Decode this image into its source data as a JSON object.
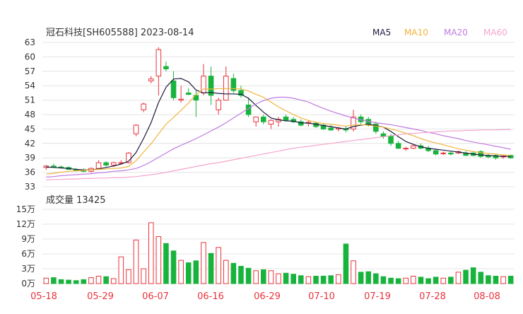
{
  "chart_data": {
    "type": "candlestick",
    "title": "冠石科技[SH605588] 2023-08-14",
    "legend": [
      {
        "name": "MA5",
        "color": "#1a1a3c"
      },
      {
        "name": "MA10",
        "color": "#f0b43c"
      },
      {
        "name": "MA20",
        "color": "#c07ae0"
      },
      {
        "name": "MA60",
        "color": "#f4a6cc"
      }
    ],
    "colors": {
      "up": "#e8343c",
      "down": "#18b33c",
      "grid": "#e4e4e4",
      "axis_text": "#333333",
      "date_text": "#e8343c"
    },
    "price_axis": {
      "ticks": [
        63,
        60,
        57,
        54,
        51,
        48,
        45,
        42,
        39,
        36,
        33
      ],
      "min": 33,
      "max": 63
    },
    "dates": [
      "05-18",
      "05-29",
      "06-07",
      "06-16",
      "06-29",
      "07-10",
      "07-19",
      "07-28",
      "08-08"
    ],
    "ohlc": [
      [
        37.0,
        37.5,
        36.5,
        37.3
      ],
      [
        37.3,
        37.8,
        37.0,
        37.1
      ],
      [
        37.1,
        37.4,
        36.8,
        37.0
      ],
      [
        37.0,
        37.2,
        36.5,
        36.6
      ],
      [
        36.6,
        36.9,
        36.2,
        36.4
      ],
      [
        36.4,
        36.8,
        36.0,
        36.2
      ],
      [
        36.2,
        37.0,
        35.9,
        36.8
      ],
      [
        36.8,
        38.5,
        36.5,
        38.0
      ],
      [
        38.0,
        38.3,
        37.2,
        37.5
      ],
      [
        37.5,
        38.2,
        37.1,
        38.0
      ],
      [
        38.0,
        38.5,
        37.6,
        38.0
      ],
      [
        38.0,
        40.2,
        37.8,
        40.0
      ],
      [
        44.0,
        46.0,
        43.5,
        45.8
      ],
      [
        49.0,
        50.5,
        48.5,
        50.2
      ],
      [
        55.0,
        56.0,
        54.5,
        55.4
      ],
      [
        56.0,
        62.0,
        52.0,
        61.5
      ],
      [
        58.0,
        59.0,
        57.0,
        57.5
      ],
      [
        55.0,
        57.0,
        51.0,
        51.5
      ],
      [
        51.0,
        54.0,
        50.5,
        51.2
      ],
      [
        52.5,
        53.5,
        52.0,
        52.2
      ],
      [
        52.0,
        53.0,
        47.5,
        51.0
      ],
      [
        52.5,
        58.5,
        52.0,
        56.0
      ],
      [
        56.0,
        58.0,
        50.0,
        52.0
      ],
      [
        49.0,
        51.5,
        48.0,
        51.0
      ],
      [
        51.0,
        58.0,
        51.0,
        56.0
      ],
      [
        55.5,
        56.5,
        52.5,
        53.0
      ],
      [
        53.0,
        54.0,
        51.5,
        52.0
      ],
      [
        50.0,
        51.5,
        47.5,
        48.0
      ],
      [
        46.5,
        47.5,
        45.5,
        47.5
      ],
      [
        47.5,
        48.0,
        46.0,
        46.5
      ],
      [
        46.0,
        47.0,
        45.0,
        46.8
      ],
      [
        46.5,
        47.5,
        45.5,
        47.0
      ],
      [
        47.5,
        48.0,
        46.5,
        46.8
      ],
      [
        47.0,
        47.5,
        46.2,
        46.5
      ],
      [
        46.5,
        47.0,
        45.5,
        45.8
      ],
      [
        46.2,
        46.8,
        45.5,
        46.4
      ],
      [
        46.2,
        46.5,
        45.2,
        45.5
      ],
      [
        45.8,
        46.2,
        44.8,
        45.0
      ],
      [
        45.2,
        45.8,
        44.6,
        44.8
      ],
      [
        45.0,
        45.5,
        44.5,
        45.2
      ],
      [
        45.0,
        45.5,
        44.3,
        44.8
      ],
      [
        45.0,
        49.0,
        44.5,
        47.5
      ],
      [
        47.5,
        48.0,
        46.0,
        46.5
      ],
      [
        47.0,
        47.5,
        45.5,
        46.0
      ],
      [
        46.0,
        46.5,
        44.0,
        44.5
      ],
      [
        44.0,
        44.5,
        43.0,
        43.5
      ],
      [
        43.5,
        44.0,
        41.5,
        42.0
      ],
      [
        42.0,
        42.5,
        40.8,
        41.0
      ],
      [
        41.0,
        41.3,
        40.5,
        41.0
      ],
      [
        41.0,
        41.8,
        40.8,
        41.5
      ],
      [
        41.5,
        42.0,
        40.8,
        41.0
      ],
      [
        41.0,
        41.5,
        40.2,
        40.5
      ],
      [
        40.5,
        40.8,
        39.5,
        39.8
      ],
      [
        40.0,
        40.3,
        39.6,
        40.0
      ],
      [
        40.0,
        40.3,
        39.5,
        39.8
      ],
      [
        40.0,
        40.5,
        39.8,
        40.3
      ],
      [
        40.0,
        40.4,
        39.4,
        39.5
      ],
      [
        40.0,
        40.3,
        39.3,
        39.5
      ],
      [
        40.3,
        40.6,
        39.0,
        39.3
      ],
      [
        39.5,
        39.8,
        38.9,
        39.2
      ],
      [
        39.5,
        39.8,
        38.6,
        39.0
      ],
      [
        39.2,
        39.5,
        38.8,
        39.4
      ],
      [
        39.5,
        39.7,
        38.8,
        39.0
      ]
    ],
    "ma": {
      "MA5": [
        37.1,
        37.0,
        36.9,
        36.8,
        36.6,
        36.5,
        36.5,
        36.7,
        37.0,
        37.3,
        37.7,
        38.3,
        40.1,
        43.0,
        46.3,
        50.5,
        53.7,
        55.4,
        55.5,
        54.8,
        53.1,
        52.5,
        52.6,
        52.4,
        52.3,
        52.3,
        52.2,
        51.4,
        49.9,
        48.5,
        47.3,
        46.9,
        46.7,
        46.6,
        46.3,
        46.2,
        46.0,
        45.7,
        45.5,
        45.2,
        45.0,
        45.5,
        45.8,
        46.0,
        45.7,
        45.4,
        44.5,
        43.4,
        42.4,
        41.8,
        41.3,
        41.0,
        40.8,
        40.6,
        40.4,
        40.2,
        40.0,
        39.8,
        39.6,
        39.5,
        39.4,
        39.3,
        39.3
      ],
      "MA10": [
        35.6,
        35.8,
        36.0,
        36.2,
        36.3,
        36.4,
        36.5,
        36.6,
        36.7,
        36.8,
        36.9,
        37.2,
        38.4,
        40.2,
        41.9,
        44.0,
        46.0,
        47.4,
        48.9,
        50.4,
        52.2,
        53.3,
        53.3,
        53.4,
        53.4,
        53.4,
        53.3,
        52.9,
        52.2,
        51.6,
        50.6,
        49.6,
        48.8,
        48.0,
        47.3,
        46.8,
        46.4,
        46.1,
        46.0,
        45.8,
        45.6,
        45.8,
        45.9,
        45.8,
        45.6,
        45.4,
        45.0,
        44.6,
        44.1,
        43.6,
        43.0,
        42.5,
        42.1,
        41.7,
        41.3,
        40.9,
        40.6,
        40.3,
        40.1,
        39.9,
        39.8,
        39.6,
        39.5
      ],
      "MA20": [
        35.0,
        35.1,
        35.3,
        35.4,
        35.5,
        35.6,
        35.7,
        35.9,
        36.0,
        36.2,
        36.3,
        36.5,
        36.8,
        37.4,
        38.2,
        39.1,
        40.0,
        40.9,
        41.6,
        42.3,
        43.0,
        43.8,
        44.6,
        45.4,
        46.3,
        47.3,
        48.3,
        49.3,
        50.2,
        50.9,
        51.4,
        51.6,
        51.6,
        51.4,
        51.0,
        50.6,
        49.9,
        49.3,
        48.7,
        48.2,
        47.7,
        47.3,
        46.9,
        46.6,
        46.3,
        46.1,
        45.9,
        45.6,
        45.3,
        45.0,
        44.7,
        44.3,
        44.0,
        43.6,
        43.3,
        43.0,
        42.6,
        42.3,
        42.0,
        41.7,
        41.4,
        41.1,
        40.8
      ],
      "MA60": [
        34.4,
        34.5,
        34.5,
        34.6,
        34.6,
        34.7,
        34.7,
        34.8,
        34.8,
        34.9,
        34.9,
        35.0,
        35.1,
        35.3,
        35.5,
        35.7,
        36.0,
        36.3,
        36.6,
        36.9,
        37.2,
        37.5,
        37.8,
        38.0,
        38.3,
        38.6,
        38.9,
        39.2,
        39.5,
        39.8,
        40.1,
        40.4,
        40.7,
        41.0,
        41.2,
        41.4,
        41.6,
        41.8,
        42.0,
        42.2,
        42.4,
        42.6,
        42.8,
        43.0,
        43.2,
        43.4,
        43.6,
        43.8,
        44.0,
        44.1,
        44.2,
        44.3,
        44.4,
        44.5,
        44.6,
        44.6,
        44.7,
        44.7,
        44.8,
        44.8,
        44.8,
        44.9,
        44.9
      ]
    },
    "volume_label": "成交量 13425",
    "volume_axis": {
      "ticks": [
        "15万",
        "12万",
        "9万",
        "6万",
        "3万",
        "0万"
      ],
      "max": 15
    },
    "volume": [
      1.1,
      1.2,
      0.8,
      0.7,
      0.6,
      0.8,
      1.2,
      1.5,
      1.4,
      1.0,
      5.4,
      2.8,
      8.8,
      3.0,
      12.3,
      9.5,
      8.1,
      6.6,
      4.7,
      4.2,
      4.6,
      8.3,
      6.1,
      7.3,
      4.7,
      4.1,
      3.5,
      3.1,
      2.6,
      2.8,
      2.6,
      2.0,
      2.1,
      1.9,
      1.6,
      1.4,
      1.5,
      1.5,
      1.6,
      1.8,
      8.0,
      4.6,
      2.3,
      2.4,
      2.0,
      1.4,
      1.1,
      1.0,
      1.1,
      1.5,
      1.3,
      1.0,
      1.3,
      1.1,
      1.3,
      2.3,
      2.7,
      3.2,
      2.3,
      1.6,
      1.5,
      1.4,
      1.5
    ]
  }
}
